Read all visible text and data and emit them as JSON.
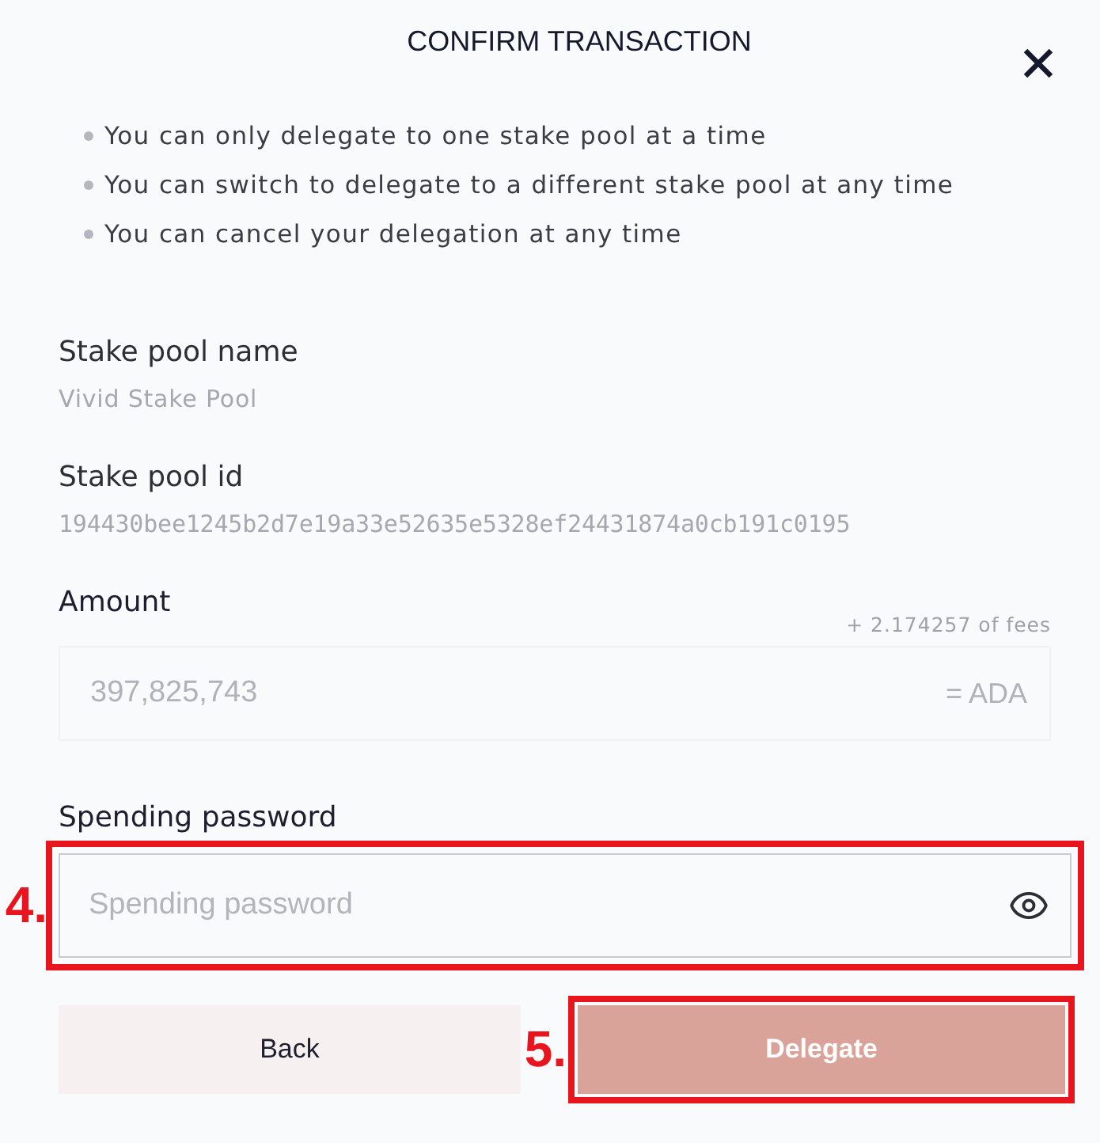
{
  "dialog": {
    "title": "CONFIRM TRANSACTION"
  },
  "notes": [
    "You can only delegate to one stake pool at a time",
    "You can switch to delegate to a different stake pool at any time",
    "You can cancel your delegation at any time"
  ],
  "pool_name": {
    "label": "Stake pool name",
    "value": "Vivid Stake Pool"
  },
  "pool_id": {
    "label": "Stake pool id",
    "value": "194430bee1245b2d7e19a33e52635e5328ef24431874a0cb191c0195"
  },
  "amount": {
    "label": "Amount",
    "fees": "+ 2.174257 of fees",
    "value": "397,825,743",
    "currency": "= ADA"
  },
  "password": {
    "label": "Spending password",
    "placeholder": "Spending password",
    "annotation": "4."
  },
  "buttons": [
    {
      "label": "Back",
      "kind": "secondary",
      "disabled": false
    },
    {
      "label": "Delegate",
      "kind": "primary",
      "disabled": true,
      "annotation": "5."
    }
  ]
}
